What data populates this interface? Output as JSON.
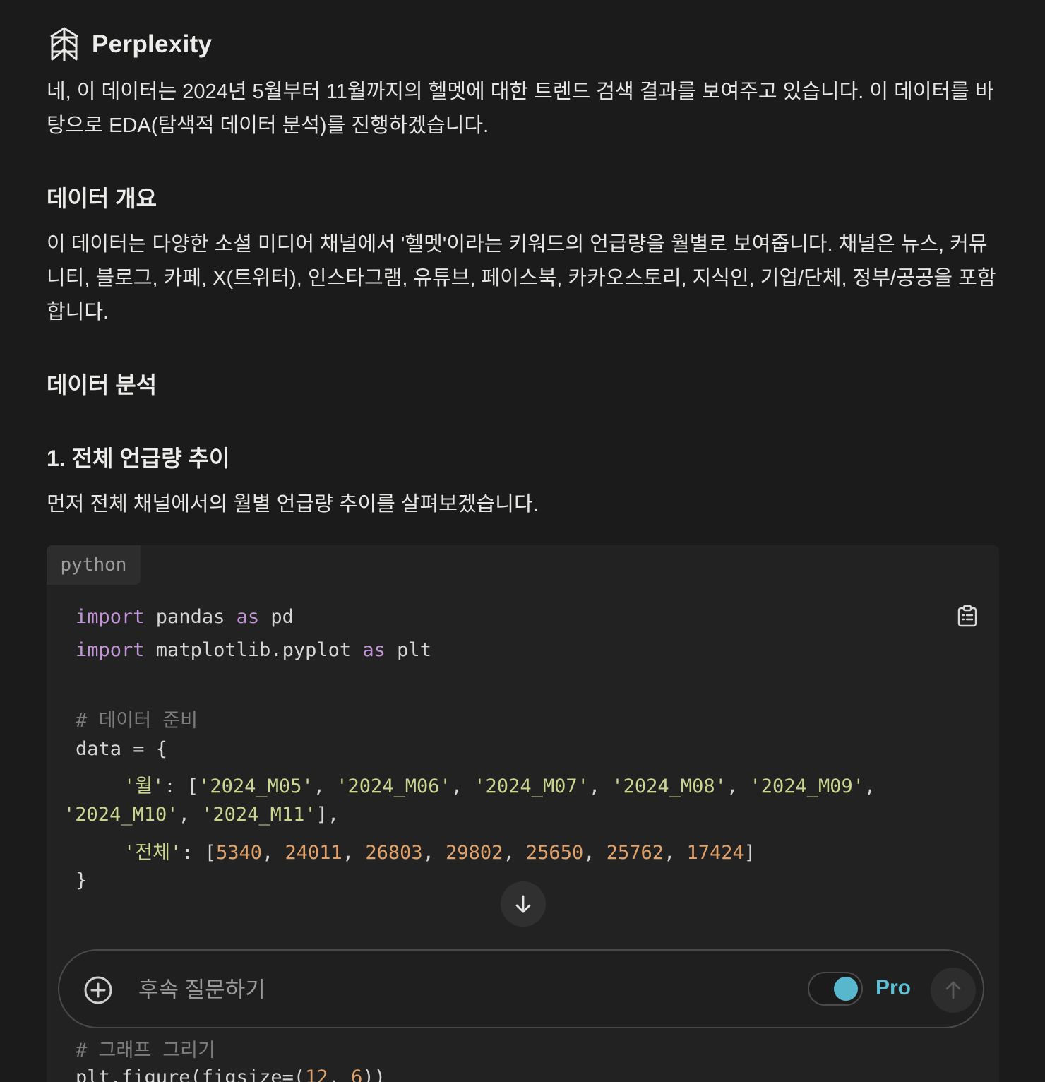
{
  "header": {
    "brand": "Perplexity",
    "logo_icon": "perplexity-logo-icon"
  },
  "answer": {
    "intro": "네, 이 데이터는 2024년 5월부터 11월까지의 헬멧에 대한 트렌드 검색 결과를 보여주고 있습니다. 이 데이터를 바탕으로 EDA(탐색적 데이터 분석)를 진행하겠습니다.",
    "h_overview": "데이터 개요",
    "p_overview": "이 데이터는 다양한 소셜 미디어 채널에서 '헬멧'이라는 키워드의 언급량을 월별로 보여줍니다. 채널은 뉴스, 커뮤니티, 블로그, 카페, X(트위터), 인스타그램, 유튜브, 페이스북, 카카오스토리, 지식인, 기업/단체, 정부/공공을 포함합니다.",
    "h_analysis": "데이터 분석",
    "h_trend": "1. 전체 언급량 추이",
    "p_trend": "먼저 전체 채널에서의 월별 언급량 추이를 살펴보겠습니다."
  },
  "code_block": {
    "language": "python",
    "copy_icon": "clipboard-icon",
    "kw_import": "import",
    "kw_as": "as",
    "mod_pandas": " pandas ",
    "alias_pd": " pd",
    "mod_mpl": " matplotlib.pyplot ",
    "alias_plt": " plt",
    "comment_prep": "# 데이터 준비",
    "data_open": "data = {",
    "key_month": "'월'",
    "colon": ": [",
    "months": [
      "'2024_M05'",
      "'2024_M06'",
      "'2024_M07'",
      "'2024_M08'",
      "'2024_M09'",
      "'2024_M10'",
      "'2024_M11'"
    ],
    "key_total": "'전체'",
    "totals": [
      "5340",
      "24011",
      "26803",
      "29802",
      "25650",
      "25762",
      "17424"
    ],
    "sep": ", ",
    "close_list": "],",
    "close_bracket": "]",
    "data_close": "}",
    "comment_graph": "# 그래프 그리기",
    "partial_line_a": "plt.figure(figsize=(",
    "partial_nums": [
      "12",
      "6"
    ],
    "partial_line_end": "))"
  },
  "composer": {
    "placeholder": "후속 질문하기",
    "pro_label": "Pro",
    "pro_enabled": true,
    "accent_color": "#5fbfd4"
  }
}
